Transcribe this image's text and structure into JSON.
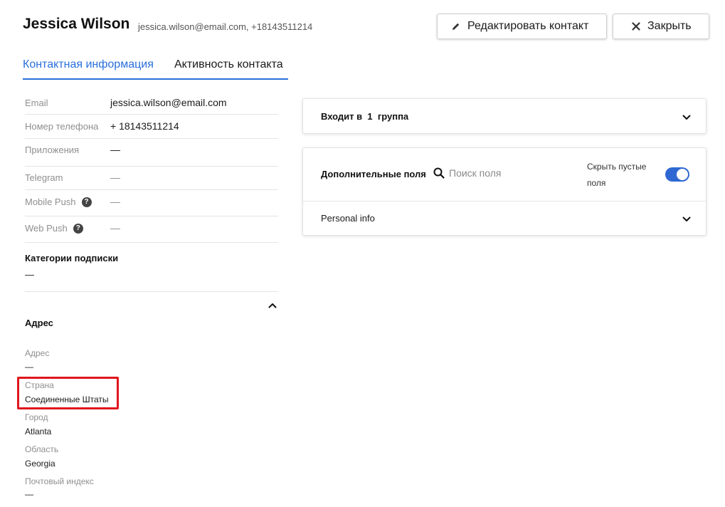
{
  "header": {
    "name": "Jessica Wilson",
    "subtitle": "jessica.wilson@email.com, +18143511214"
  },
  "actions": {
    "edit_label": "Редактировать контакт",
    "close_label": "Закрыть"
  },
  "tabs": [
    {
      "label": "Контактная информация",
      "active": true
    },
    {
      "label": "Активность контакта",
      "active": false
    }
  ],
  "contact_fields": [
    {
      "label": "Email",
      "value": "jessica.wilson@email.com"
    },
    {
      "label": "Номер телефона",
      "value": "+ 18143511214"
    },
    {
      "label": "Приложения",
      "value": "—"
    },
    {
      "label": "Telegram",
      "value": "—"
    },
    {
      "label": "Mobile Push",
      "value": "—",
      "help": "?"
    },
    {
      "label": "Web Push",
      "value": "—",
      "help": "?"
    }
  ],
  "subscription": {
    "title": "Категории подписки",
    "value": "—"
  },
  "address": {
    "title": "Адрес",
    "fields": [
      {
        "label": "Адрес",
        "value": "—"
      },
      {
        "label": "Страна",
        "value": "Соединенные Штаты"
      },
      {
        "label": "Город",
        "value": "Atlanta"
      },
      {
        "label": "Область",
        "value": "Georgia"
      },
      {
        "label": "Почтовый индекс",
        "value": "—"
      }
    ]
  },
  "groups_card": {
    "prefix": "Входит в",
    "count": "1",
    "suffix": "группа"
  },
  "extra_fields_card": {
    "title": "Дополнительные поля",
    "search_placeholder": "Поиск поля",
    "hide_empty_label": "Скрыть пустые поля",
    "hide_empty_on": true,
    "section": "Personal info"
  },
  "colors": {
    "accent": "#2a6fdb",
    "toggle_on": "#2f68d2",
    "highlight": "#e0161d"
  }
}
